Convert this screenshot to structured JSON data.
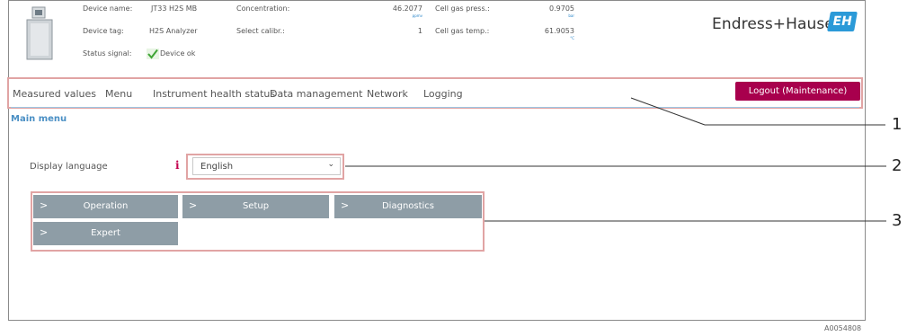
{
  "header": {
    "device_name_label": "Device name:",
    "device_name_value": "JT33 H2S MB",
    "device_tag_label": "Device tag:",
    "device_tag_value": "H2S Analyzer",
    "status_signal_label": "Status signal:",
    "status_signal_value": "Device ok",
    "concentration_label": "Concentration:",
    "concentration_value": "46.2077",
    "concentration_unit": "ppmv",
    "select_calibr_label": "Select calibr.:",
    "select_calibr_value": "1",
    "cell_gas_press_label": "Cell gas press.:",
    "cell_gas_press_value": "0.9705",
    "cell_gas_press_unit": "bar",
    "cell_gas_temp_label": "Cell gas temp.:",
    "cell_gas_temp_value": "61.9053",
    "cell_gas_temp_unit": "°C",
    "brand": "Endress+Hauser",
    "brand_logo_text": "EH"
  },
  "nav": {
    "items": [
      "Measured values",
      "Menu",
      "Instrument health status",
      "Data management",
      "Network",
      "Logging"
    ],
    "logout_label": "Logout (Maintenance)"
  },
  "main": {
    "title": "Main menu",
    "display_language_label": "Display language",
    "language_value": "English",
    "buttons": [
      "Operation",
      "Setup",
      "Diagnostics",
      "Expert"
    ]
  },
  "callouts": [
    "1",
    "2",
    "3"
  ],
  "figure_id": "A0054808",
  "colors": {
    "logout_bg": "#a8004d",
    "menu_button_bg": "#8e9da6",
    "title_blue": "#4a8fc4",
    "highlight_box": "#e1a4a4",
    "logo_blue": "#2b9ad8"
  }
}
